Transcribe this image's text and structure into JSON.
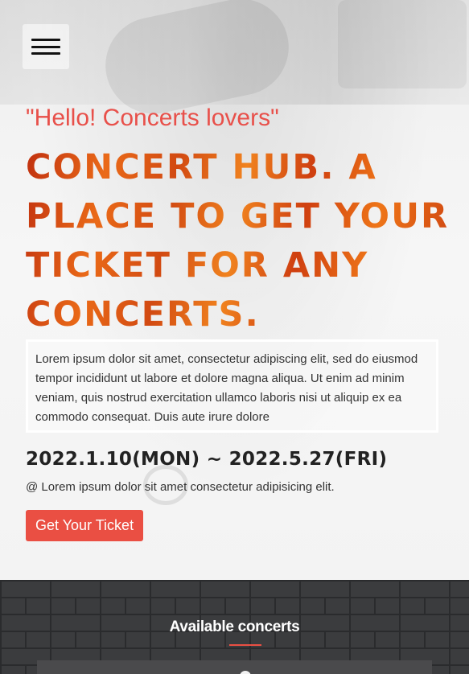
{
  "hero": {
    "greeting": "\"Hello! Concerts lovers\"",
    "headline": "CONCERT HUB. A PLACE TO GET YOUR TICKET FOR ANY CONCERTS.",
    "intro": "Lorem ipsum dolor sit amet, consectetur adipiscing elit, sed do eiusmod tempor incididunt ut labore et dolore magna aliqua. Ut enim ad minim veniam, quis nostrud exercitation ullamco laboris nisi ut aliquip ex ea commodo consequat. Duis aute irure dolore",
    "dates": "2022.1.10(MON) ~ 2022.5.27(FRI)",
    "location": "@ Lorem ipsum dolor sit amet consectetur adipisicing elit.",
    "ticket_button": "Get Your Ticket"
  },
  "concerts": {
    "title": "Available concerts"
  },
  "colors": {
    "accent": "#ea4f43",
    "greeting": "#e8504a",
    "headline_orange": "#ea6a18",
    "section_bg": "#3b3c3e"
  },
  "icons": {
    "menu": "hamburger-icon"
  }
}
